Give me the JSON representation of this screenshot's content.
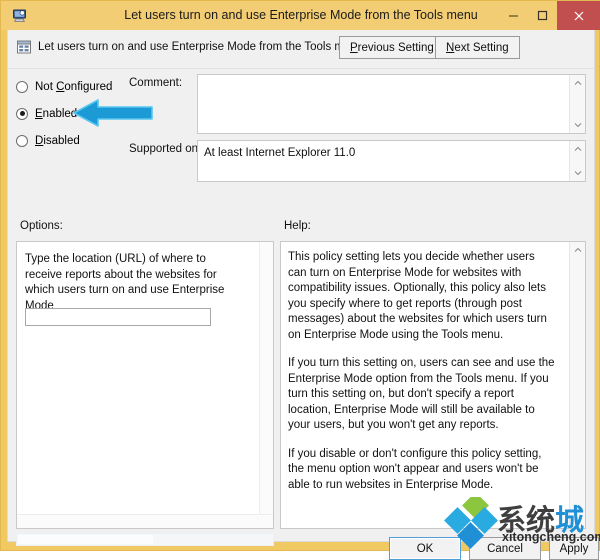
{
  "window": {
    "title": "Let users turn on and use Enterprise Mode from the Tools menu",
    "title_icon": "policy-computer-icon",
    "titlebar_color": "#f2cd74",
    "frame_color": "#f0c963",
    "close_button_color": "#c14f50",
    "controls": {
      "minimize": "–",
      "maximize": "❐",
      "close": "✕"
    }
  },
  "header": {
    "icon": "policy-setting-icon",
    "title": "Let users turn on and use Enterprise Mode from the Tools menu",
    "previous_setting": {
      "pre": "",
      "acc": "P",
      "post": "revious Setting"
    },
    "next_setting": {
      "pre": "",
      "acc": "N",
      "post": "ext Setting"
    }
  },
  "state_options": {
    "selected": "Enabled",
    "items": [
      {
        "label_pre": "Not ",
        "label_acc": "C",
        "label_post": "onfigured",
        "value": "Not Configured",
        "selected": false
      },
      {
        "label_pre": "",
        "label_acc": "E",
        "label_post": "nabled",
        "value": "Enabled",
        "selected": true
      },
      {
        "label_pre": "",
        "label_acc": "D",
        "label_post": "isabled",
        "value": "Disabled",
        "selected": false
      }
    ]
  },
  "comment": {
    "label": "Comment:",
    "value": "",
    "placeholder": ""
  },
  "supported_on": {
    "label": "Supported on:",
    "value": "At least Internet Explorer 11.0"
  },
  "options": {
    "caption": "Options:",
    "description": "Type the location (URL) of where to receive reports about the websites for which users turn on and use Enterprise Mode",
    "url_field": {
      "value": "",
      "placeholder": ""
    }
  },
  "help": {
    "caption": "Help:",
    "paragraphs": [
      "This policy setting lets you decide whether users can turn on Enterprise Mode for websites with compatibility issues. Optionally, this policy also lets you specify where to get reports (through post messages) about the websites for which users turn on Enterprise Mode using the Tools menu.",
      "If you turn this setting on, users can see and use the Enterprise Mode option from the Tools menu. If you turn this setting on, but don't specify a report location, Enterprise Mode will still be available to your users, but you won't get any reports.",
      "If you disable or don't configure this policy setting, the menu option won't appear and users won't be able to run websites in Enterprise Mode."
    ]
  },
  "footer": {
    "ok": "OK",
    "cancel": "Cancel",
    "apply": "Apply"
  },
  "annotation": {
    "arrow": "left-pointing-arrow",
    "arrow_color": "#1b9ad6",
    "points_at": "Enabled"
  },
  "watermark": {
    "text_cn_dark": "系统",
    "text_cn_blue": "城",
    "url": "xitongcheng.com",
    "diamond_colors": [
      "#8cc63f",
      "#29abe2",
      "#1f8fd6"
    ]
  }
}
